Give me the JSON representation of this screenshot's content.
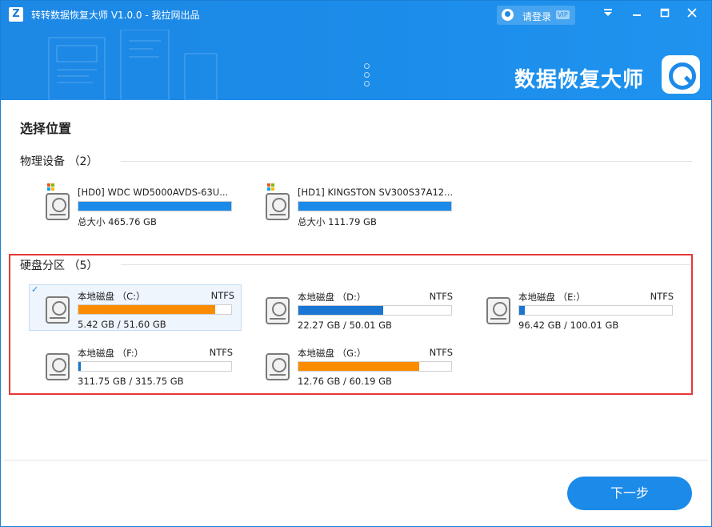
{
  "window": {
    "title": "转转数据恢复大师 V1.0.0 - 我拉网出品",
    "login_label": "请登录",
    "vip_badge": "VIP",
    "brand": "数据恢复大师"
  },
  "page": {
    "title": "选择位置"
  },
  "physical": {
    "label": "物理设备 （2）",
    "devices": [
      {
        "name": "[HD0] WDC WD5000AVDS-63U...",
        "size": "总大小 465.76 GB",
        "fill": 1.0
      },
      {
        "name": "[HD1] KINGSTON SV300S37A12...",
        "size": "总大小 111.79 GB",
        "fill": 1.0
      }
    ]
  },
  "partitions": {
    "label": "硬盘分区 （5）",
    "items": [
      {
        "name": "本地磁盘 （C:）",
        "fs": "NTFS",
        "usage": "5.42 GB / 51.60 GB",
        "free_ratio": 0.895,
        "bar_color": "#fb8c00",
        "selected": true
      },
      {
        "name": "本地磁盘 （D:）",
        "fs": "NTFS",
        "usage": "22.27 GB / 50.01 GB",
        "free_ratio": 0.555,
        "bar_color": "#1976d2",
        "selected": false
      },
      {
        "name": "本地磁盘 （E:）",
        "fs": "NTFS",
        "usage": "96.42 GB / 100.01 GB",
        "free_ratio": 0.036,
        "bar_color": "#1976d2",
        "selected": false
      },
      {
        "name": "本地磁盘 （F:）",
        "fs": "NTFS",
        "usage": "311.75 GB / 315.75 GB",
        "free_ratio": 0.013,
        "bar_color": "#1976d2",
        "selected": false
      },
      {
        "name": "本地磁盘 （G:）",
        "fs": "NTFS",
        "usage": "12.76 GB / 60.19 GB",
        "free_ratio": 0.788,
        "bar_color": "#fb8c00",
        "selected": false
      }
    ]
  },
  "footer": {
    "next_label": "下一步"
  },
  "colors": {
    "accent": "#1b8ae8",
    "highlight_border": "#e53935"
  }
}
